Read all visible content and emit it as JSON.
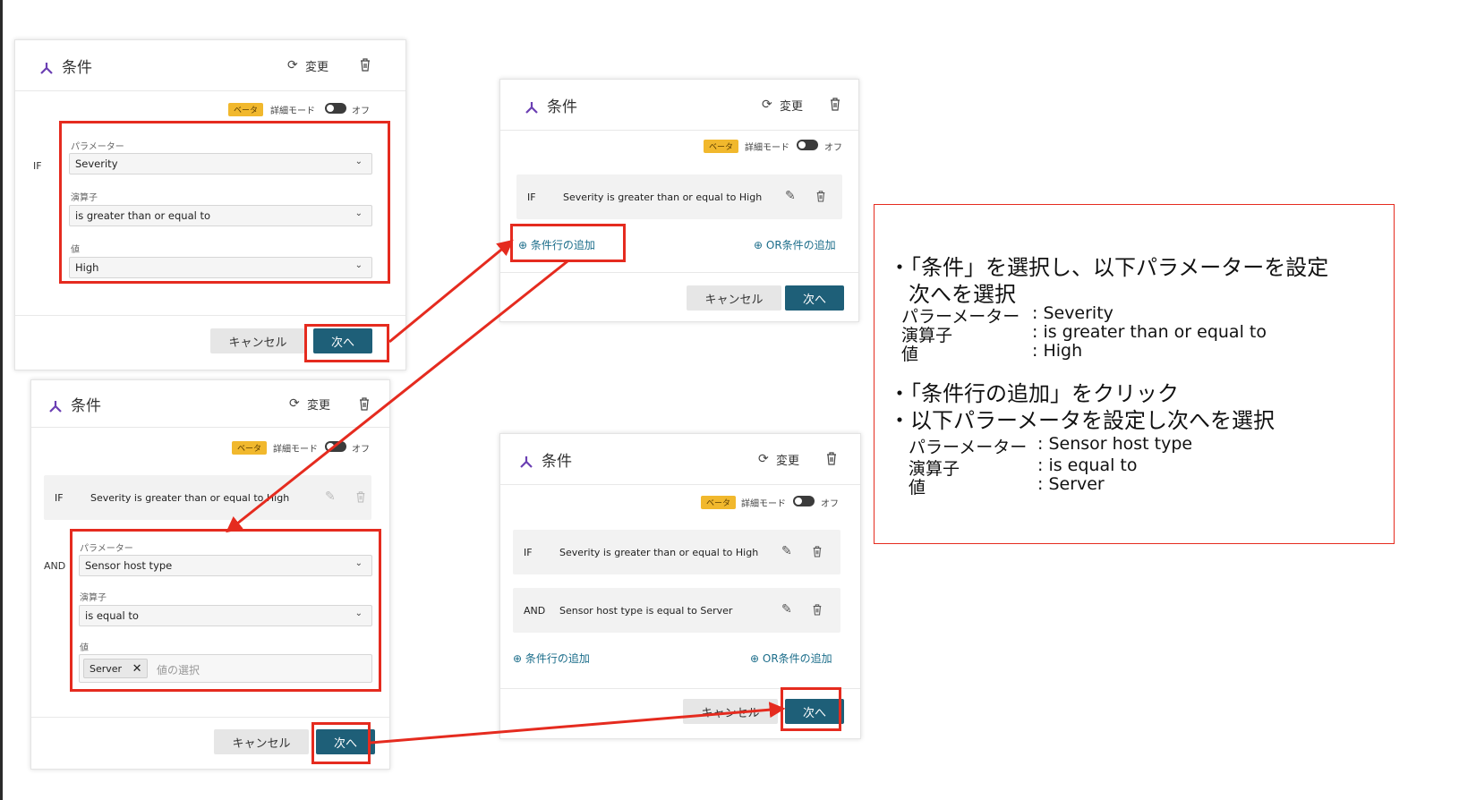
{
  "panel_common": {
    "title": "条件",
    "change": "変更",
    "beta": "ベータ",
    "detail_mode": "詳細モード",
    "toggle_state": "オフ",
    "cancel": "キャンセル",
    "next": "次へ",
    "add_condition_row": "条件行の追加",
    "add_or_condition": "OR条件の追加",
    "param_label": "パラメーター",
    "operator_label": "演算子",
    "value_label": "値",
    "if": "IF",
    "and": "AND"
  },
  "panel1": {
    "parameter": "Severity",
    "operator": "is greater than or equal to",
    "value": "High"
  },
  "condition1": "Severity is greater than or equal to High",
  "panel3": {
    "parameter": "Sensor host type",
    "operator": "is equal to",
    "value_tag": "Server",
    "value_placeholder": "値の選択"
  },
  "condition2": "Sensor host type is equal to Server",
  "instructions": {
    "line1": "・「条件」を選択し、以下パラメーターを設定",
    "line1b": "次へを選択",
    "p1_param_key": "パラーメーター",
    "p1_param_val": ": Severity",
    "p1_op_key": "演算子",
    "p1_op_val": ": is greater than or equal to",
    "p1_value_key": "値",
    "p1_value_val": ": High",
    "line2": "・「条件行の追加」をクリック",
    "line3": "・以下パラーメータを設定し次へを選択",
    "p2_param_key": "パラーメーター",
    "p2_param_val": ": Sensor host type",
    "p2_op_key": "演算子",
    "p2_op_val": ": is equal to",
    "p2_value_key": "値",
    "p2_value_val": ": Server"
  },
  "colors": {
    "accent": "#1e5f78",
    "link": "#1b6d8a",
    "highlight": "#e52b1f",
    "beta_badge": "#f1b82d"
  }
}
